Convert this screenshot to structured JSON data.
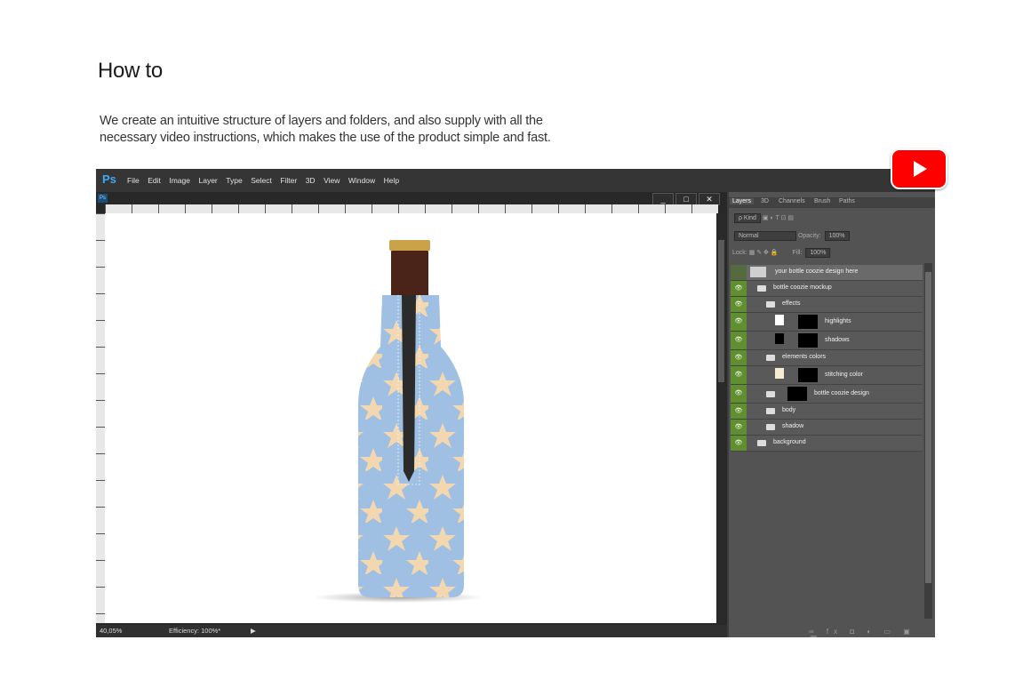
{
  "heading": "How to",
  "description": "We create an intuitive structure of layers and folders, and also supply with all the necessary video instructions, which makes the use of the product simple and fast.",
  "photoshop": {
    "logo": "Ps",
    "menu": [
      "File",
      "Edit",
      "Image",
      "Layer",
      "Type",
      "Select",
      "Filter",
      "3D",
      "View",
      "Window",
      "Help"
    ],
    "window_buttons": [
      "_",
      "□",
      "✕"
    ],
    "status": {
      "zoom": "40,05%",
      "efficiency": "Efficiency: 100%*"
    },
    "panel": {
      "tabs": [
        "Layers",
        "3D",
        "Channels",
        "Brush",
        "Paths"
      ],
      "kind_label": "ρ Kind",
      "blend_mode": "Normal",
      "opacity_label": "Opacity:",
      "opacity_value": "100%",
      "lock_label": "Lock:",
      "fill_label": "Fill:",
      "fill_value": "100%",
      "layers": [
        {
          "name": "your bottle coozie design here",
          "visible": false,
          "type": "smart"
        },
        {
          "name": "bottle coozie mockup",
          "visible": true,
          "type": "folder"
        },
        {
          "name": "effects",
          "visible": true,
          "type": "folder"
        },
        {
          "name": "highlights",
          "visible": true,
          "type": "layer"
        },
        {
          "name": "shadows",
          "visible": true,
          "type": "layer"
        },
        {
          "name": "elements colors",
          "visible": true,
          "type": "folder"
        },
        {
          "name": "stitching color",
          "visible": true,
          "type": "layer"
        },
        {
          "name": "bottle coozie design",
          "visible": true,
          "type": "folder"
        },
        {
          "name": "body",
          "visible": true,
          "type": "folder"
        },
        {
          "name": "shadow",
          "visible": true,
          "type": "folder"
        },
        {
          "name": "background",
          "visible": true,
          "type": "folder"
        }
      ]
    }
  },
  "youtube_icon": "youtube-play-icon",
  "colors": {
    "coozie_blue": "#9fc0e2",
    "star": "#f2d7b0",
    "eye_green": "#5f8f2f",
    "ps_blue": "#3fa9f5",
    "youtube_red": "#ff0000"
  }
}
